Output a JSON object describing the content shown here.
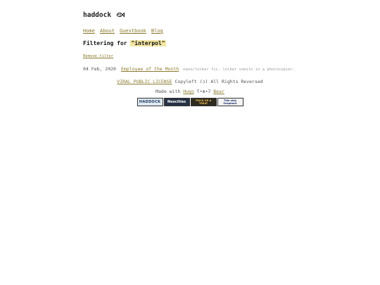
{
  "header": {
    "site_title": "haddock",
    "logo_icon": "fish-icon"
  },
  "nav": {
    "items": [
      {
        "label": "Home"
      },
      {
        "label": "About"
      },
      {
        "label": "Guestbook"
      },
      {
        "label": "Blog"
      }
    ]
  },
  "filter": {
    "prefix": "Filtering for ",
    "term": "\"interpol\"",
    "remove_label": "Remove filter"
  },
  "posts": [
    {
      "date": "04 Feb, 2020",
      "title": "Employee of the Month",
      "summary": "nano/locker fic. locker vomits in a photocopier."
    }
  ],
  "footer": {
    "license_link": "VIRAL PUBLIC LICENSE",
    "copyleft_text": " Copyleft (ɔ) All Rights Reversed",
    "made_with": "Made with ",
    "hugo_link": "Hugo",
    "bear_face": " ʕ•ᴥ•ʔ ",
    "bear_link": "Bear",
    "badges": [
      {
        "label": "HADDOCK"
      },
      {
        "label": "Neocities"
      },
      {
        "label": "TRICK OR A TREAT"
      },
      {
        "label": "Thin ship Snapback"
      }
    ]
  },
  "colors": {
    "link": "#8a7a2e",
    "highlight": "#f3e6a3"
  }
}
